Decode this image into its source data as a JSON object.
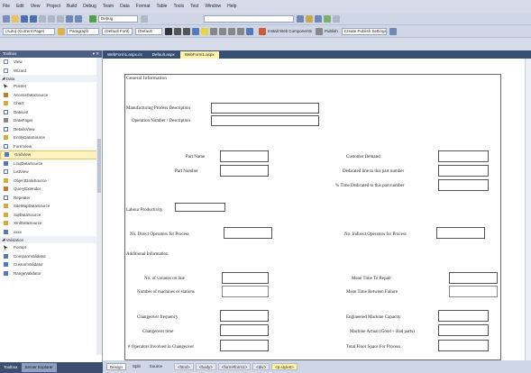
{
  "menu": [
    "File",
    "Edit",
    "View",
    "Project",
    "Build",
    "Debug",
    "Team",
    "Data",
    "Format",
    "Table",
    "Tools",
    "Test",
    "Window",
    "Help"
  ],
  "toolbar1": {
    "config": "Debug"
  },
  "toolbar2": {
    "block": "(Auto) (Current Page)",
    "paragraph": "Paragraph",
    "font": "(Default Font)",
    "size": "(Default",
    "install_label": "Install Web Components",
    "publish_label": "Publish",
    "publish_combo": "Create Publish Settings"
  },
  "toolbox": {
    "title": "Toolbox",
    "groups": {
      "data": "Data",
      "validation": "Validation"
    },
    "top_items": [
      "View",
      "Wizard"
    ],
    "data_items": [
      "Pointer",
      "AccessDataSource",
      "Chart",
      "DataList",
      "DataPager",
      "DetailsView",
      "EntityDataSource",
      "FormView",
      "GridView",
      "LinqDataSource",
      "ListView",
      "ObjectDataSource",
      "QueryExtender",
      "Repeater",
      "SiteMapDataSource",
      "SqlDataSource",
      "XmlDataSource",
      "xxxx"
    ],
    "validation_items": [
      "Pointer",
      "CompareValidator",
      "CustomValidator",
      "RangeValidator"
    ]
  },
  "bottom_tabs": {
    "toolbox": "Toolbox",
    "server_explorer": "Server Explorer"
  },
  "doc_tabs": [
    "WebForm1.aspx.cs",
    "Default.aspx",
    "WebForm1.aspx"
  ],
  "form": {
    "section_general": "General Information",
    "mfg_desc": "Manufacturing Process Description",
    "op_desc": "Operation Number / Description",
    "part_name": "Part Name",
    "part_number": "Part Number",
    "customer_demand": "Customer Demand",
    "dedicated_line": "Dedicated line to this part number",
    "time_dedicated": "% Time Dedicated to this part number",
    "labour_productivity": "Labour Productivity",
    "no_direct": "No. Direct Operators for Process",
    "no_indirect": "No. Indirect Operators for Process",
    "additional_info": "Additional Information",
    "no_variants": "No. of variants on line",
    "no_machines": "Number of machines or stations",
    "mttr": "Mean Time To Repair",
    "mtbf": "Mean Time Between Failure",
    "changeover_freq": "Changeover frequency",
    "changeover_time": "Changeover time",
    "operators_changeover": "# Operators Involved in Changeover",
    "engineered_capacity": "Engineered Machine Capacity",
    "machine_actual": "Machine Actual (Good + Bad parts)",
    "total_floor": "Total Floor Space For Process"
  },
  "design_bar": {
    "design": "Design",
    "split": "Split",
    "source": "Source",
    "crumbs": [
      "<html>",
      "<body>",
      "<form#form1>",
      "<div>",
      "<p.style6>"
    ]
  }
}
